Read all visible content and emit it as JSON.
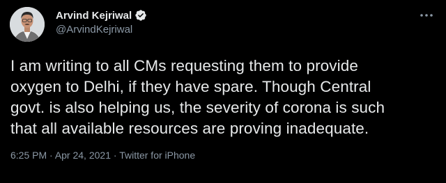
{
  "author": {
    "display_name": "Arvind Kejriwal",
    "handle": "@ArvindKejriwal",
    "verified": true
  },
  "tweet": {
    "text": "I am writing to all CMs requesting them to provide\noxygen to Delhi, if they have spare. Though Central\ngovt. is also helping us, the severity of corona is such\nthat all available resources are proving inadequate.",
    "time": "6:25 PM",
    "separator": " · ",
    "date": "Apr 24, 2021",
    "source": "Twitter for iPhone"
  },
  "icons": {
    "verified": "verified-badge-icon",
    "more": "more-options-icon"
  },
  "colors": {
    "background": "#000000",
    "primary_text": "#e7e9ea",
    "secondary_text": "#8b98a5"
  }
}
